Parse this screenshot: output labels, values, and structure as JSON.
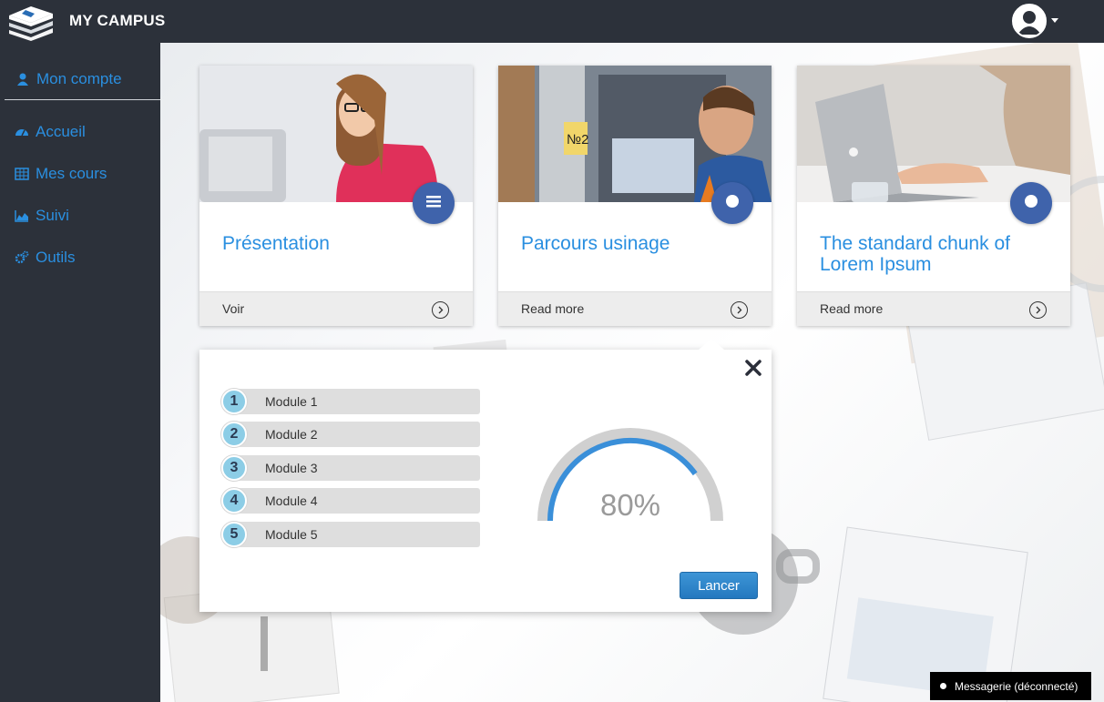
{
  "app": {
    "title": "MY CAMPUS"
  },
  "sidebar": {
    "account": {
      "label": "Mon compte",
      "icon": "user-icon"
    },
    "items": [
      {
        "label": "Accueil",
        "icon": "dashboard-icon"
      },
      {
        "label": "Mes cours",
        "icon": "table-icon"
      },
      {
        "label": "Suivi",
        "icon": "area-chart-icon"
      },
      {
        "label": "Outils",
        "icon": "cogs-icon"
      }
    ]
  },
  "cards": [
    {
      "title": "Présentation",
      "link": "Voir",
      "badge_icon": "menu-icon"
    },
    {
      "title": "Parcours usinage",
      "link": "Read more",
      "badge_icon": "circle-icon"
    },
    {
      "title": "The standard chunk of Lorem Ipsum",
      "link": "Read more",
      "badge_icon": "circle-icon"
    }
  ],
  "popover": {
    "modules": [
      {
        "num": "1",
        "label": "Module 1"
      },
      {
        "num": "2",
        "label": "Module 2"
      },
      {
        "num": "3",
        "label": "Module 3"
      },
      {
        "num": "4",
        "label": "Module 4"
      },
      {
        "num": "5",
        "label": "Module 5"
      }
    ],
    "progress": {
      "value": 0.8,
      "label": "80%"
    },
    "launch_label": "Lancer"
  },
  "chat": {
    "label": "Messagerie (déconnecté)"
  },
  "colors": {
    "accent": "#2a8fe0",
    "badge": "#3f63ab",
    "gauge": "#3a8fd9",
    "sidebar": "#2c313a"
  }
}
